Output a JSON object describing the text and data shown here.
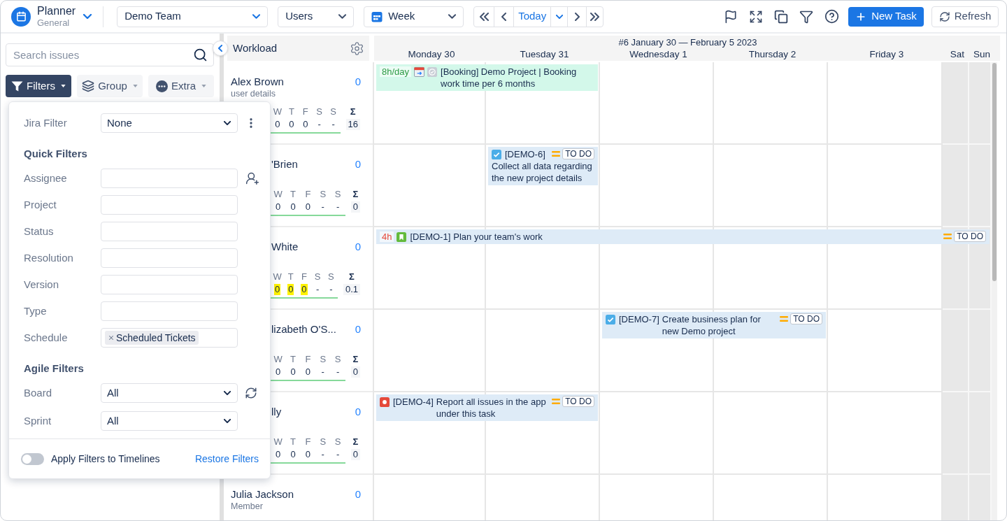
{
  "app": {
    "title": "Planner",
    "subtitle": "General"
  },
  "toolbar": {
    "team": "Demo Team",
    "group_by": "Users",
    "view": "Week",
    "today": "Today",
    "new_task": "New Task",
    "refresh": "Refresh"
  },
  "sidebar": {
    "search": {
      "placeholder": "Search issues"
    },
    "buttons": [
      {
        "kind": "filters",
        "label": "Filters",
        "open": true
      },
      {
        "kind": "group",
        "label": "Group",
        "open": false
      },
      {
        "kind": "extra",
        "label": "Extra",
        "open": false
      }
    ]
  },
  "filter_panel": {
    "jira_filter": {
      "label": "Jira Filter",
      "value": "None"
    },
    "quick_filters": {
      "title": "Quick Filters",
      "fields": [
        {
          "kind": "user",
          "label": "Assignee"
        },
        {
          "kind": "text",
          "label": "Project"
        },
        {
          "kind": "text",
          "label": "Status"
        },
        {
          "kind": "text",
          "label": "Resolution"
        },
        {
          "kind": "text",
          "label": "Version"
        },
        {
          "kind": "text",
          "label": "Type"
        },
        {
          "kind": "tags",
          "label": "Schedule",
          "tags": [
            "Scheduled Tickets"
          ]
        }
      ]
    },
    "agile_filters": {
      "title": "Agile Filters",
      "fields": [
        {
          "kind": "refresh",
          "label": "Board",
          "value": "All"
        },
        {
          "kind": "plain",
          "label": "Sprint",
          "value": "All"
        }
      ]
    },
    "apply_to_timelines": {
      "label": "Apply Filters to Timelines",
      "on": false
    },
    "restore": "Restore Filters"
  },
  "workload": {
    "title": "Workload",
    "rows": [
      {
        "kind": "open",
        "name": "Alex Brown",
        "subtitle": "user details",
        "count": "0",
        "stats": {
          "days": [
            "W",
            "T",
            "F",
            "S",
            "S"
          ],
          "sum_label": "Σ",
          "values": [
            {
              "text": "0",
              "highlighted": false
            },
            {
              "text": "0",
              "highlighted": false
            },
            {
              "text": "0",
              "highlighted": false
            },
            {
              "text": "-",
              "highlighted": false
            },
            {
              "text": "-",
              "highlighted": false
            }
          ],
          "total": "16"
        }
      },
      {
        "kind": "covered",
        "name": "'Brien",
        "count": "0",
        "stats": {
          "days": [
            "W",
            "T",
            "F",
            "S",
            "S"
          ],
          "sum_label": "Σ",
          "values": [
            {
              "text": "0",
              "highlighted": false
            },
            {
              "text": "0",
              "highlighted": false
            },
            {
              "text": "0",
              "highlighted": false
            },
            {
              "text": "-",
              "highlighted": false
            },
            {
              "text": "-",
              "highlighted": false
            }
          ],
          "total": "0"
        }
      },
      {
        "kind": "covered",
        "name": "White",
        "count": "0",
        "stats": {
          "days": [
            "W",
            "T",
            "F",
            "S",
            "S"
          ],
          "sum_label": "Σ",
          "values": [
            {
              "text": "0",
              "highlighted": true
            },
            {
              "text": "0",
              "highlighted": true
            },
            {
              "text": "0",
              "highlighted": true
            },
            {
              "text": "-",
              "highlighted": false
            },
            {
              "text": "-",
              "highlighted": false
            }
          ],
          "total": "0.1"
        }
      },
      {
        "kind": "covered",
        "name": "lizabeth O'S...",
        "count": "0",
        "stats": {
          "days": [
            "W",
            "T",
            "F",
            "S",
            "S"
          ],
          "sum_label": "Σ",
          "values": [
            {
              "text": "0",
              "highlighted": false
            },
            {
              "text": "0",
              "highlighted": false
            },
            {
              "text": "0",
              "highlighted": false
            },
            {
              "text": "-",
              "highlighted": false
            },
            {
              "text": "-",
              "highlighted": false
            }
          ],
          "total": "0"
        }
      },
      {
        "kind": "covered",
        "name": "lly",
        "count": "0",
        "stats": {
          "days": [
            "W",
            "T",
            "F",
            "S",
            "S"
          ],
          "sum_label": "Σ",
          "values": [
            {
              "text": "0",
              "highlighted": false
            },
            {
              "text": "0",
              "highlighted": false
            },
            {
              "text": "0",
              "highlighted": false
            },
            {
              "text": "-",
              "highlighted": false
            },
            {
              "text": "-",
              "highlighted": false
            }
          ],
          "total": "0"
        }
      },
      {
        "kind": "open",
        "name": "Julia Jackson",
        "subtitle": "Member",
        "count": "0"
      }
    ]
  },
  "calendar": {
    "week": "#6 January 30 — February 5 2023",
    "days": [
      {
        "label": "Monday 30",
        "weekend": false
      },
      {
        "label": "Tuesday 31",
        "weekend": false
      },
      {
        "label": "Wednesday 1",
        "weekend": false
      },
      {
        "label": "Thursday 2",
        "weekend": false
      },
      {
        "label": "Friday 3",
        "weekend": false
      },
      {
        "label": "Sat",
        "weekend": true
      },
      {
        "label": "Sun",
        "weekend": true
      }
    ],
    "rows": [
      {
        "cells": [
          {
            "kind": "booking",
            "estimate": "8h/day",
            "title": "[Booking] Demo Project | Booking work time per 6 months"
          },
          {
            "kind": "span"
          },
          {
            "kind": "empty"
          },
          {
            "kind": "empty"
          },
          {
            "kind": "empty"
          },
          {
            "kind": "empty"
          },
          {
            "kind": "empty"
          }
        ]
      },
      {
        "cells": [
          {
            "kind": "empty"
          },
          {
            "kind": "task",
            "key": "[DEMO-6]",
            "summary": "Collect all data regarding the new project details",
            "status": "TO DO"
          },
          {
            "kind": "empty"
          },
          {
            "kind": "empty"
          },
          {
            "kind": "empty"
          },
          {
            "kind": "empty"
          },
          {
            "kind": "empty"
          }
        ]
      },
      {
        "cells": [
          {
            "kind": "story",
            "estimate": "4h",
            "key": "[DEMO-1]",
            "summary": "Plan your team's work",
            "status": "TO DO"
          },
          {
            "kind": "span"
          },
          {
            "kind": "span"
          },
          {
            "kind": "span"
          },
          {
            "kind": "span"
          },
          {
            "kind": "span"
          },
          {
            "kind": "span"
          }
        ]
      },
      {
        "cells": [
          {
            "kind": "empty"
          },
          {
            "kind": "empty"
          },
          {
            "kind": "task",
            "key": "[DEMO-7]",
            "summary": "Create business plan for new Demo project",
            "status": "TO DO"
          },
          {
            "kind": "span"
          },
          {
            "kind": "empty"
          },
          {
            "kind": "empty"
          },
          {
            "kind": "empty"
          }
        ]
      },
      {
        "cells": [
          {
            "kind": "bug",
            "key": "[DEMO-4]",
            "summary": "Report all issues in the app under this task",
            "status": "TO DO"
          },
          {
            "kind": "span"
          },
          {
            "kind": "empty"
          },
          {
            "kind": "empty"
          },
          {
            "kind": "empty"
          },
          {
            "kind": "empty"
          },
          {
            "kind": "empty"
          }
        ]
      },
      {
        "cells": [
          {
            "kind": "empty"
          },
          {
            "kind": "empty"
          },
          {
            "kind": "empty"
          },
          {
            "kind": "empty"
          },
          {
            "kind": "empty"
          },
          {
            "kind": "empty"
          },
          {
            "kind": "empty"
          }
        ]
      }
    ]
  }
}
